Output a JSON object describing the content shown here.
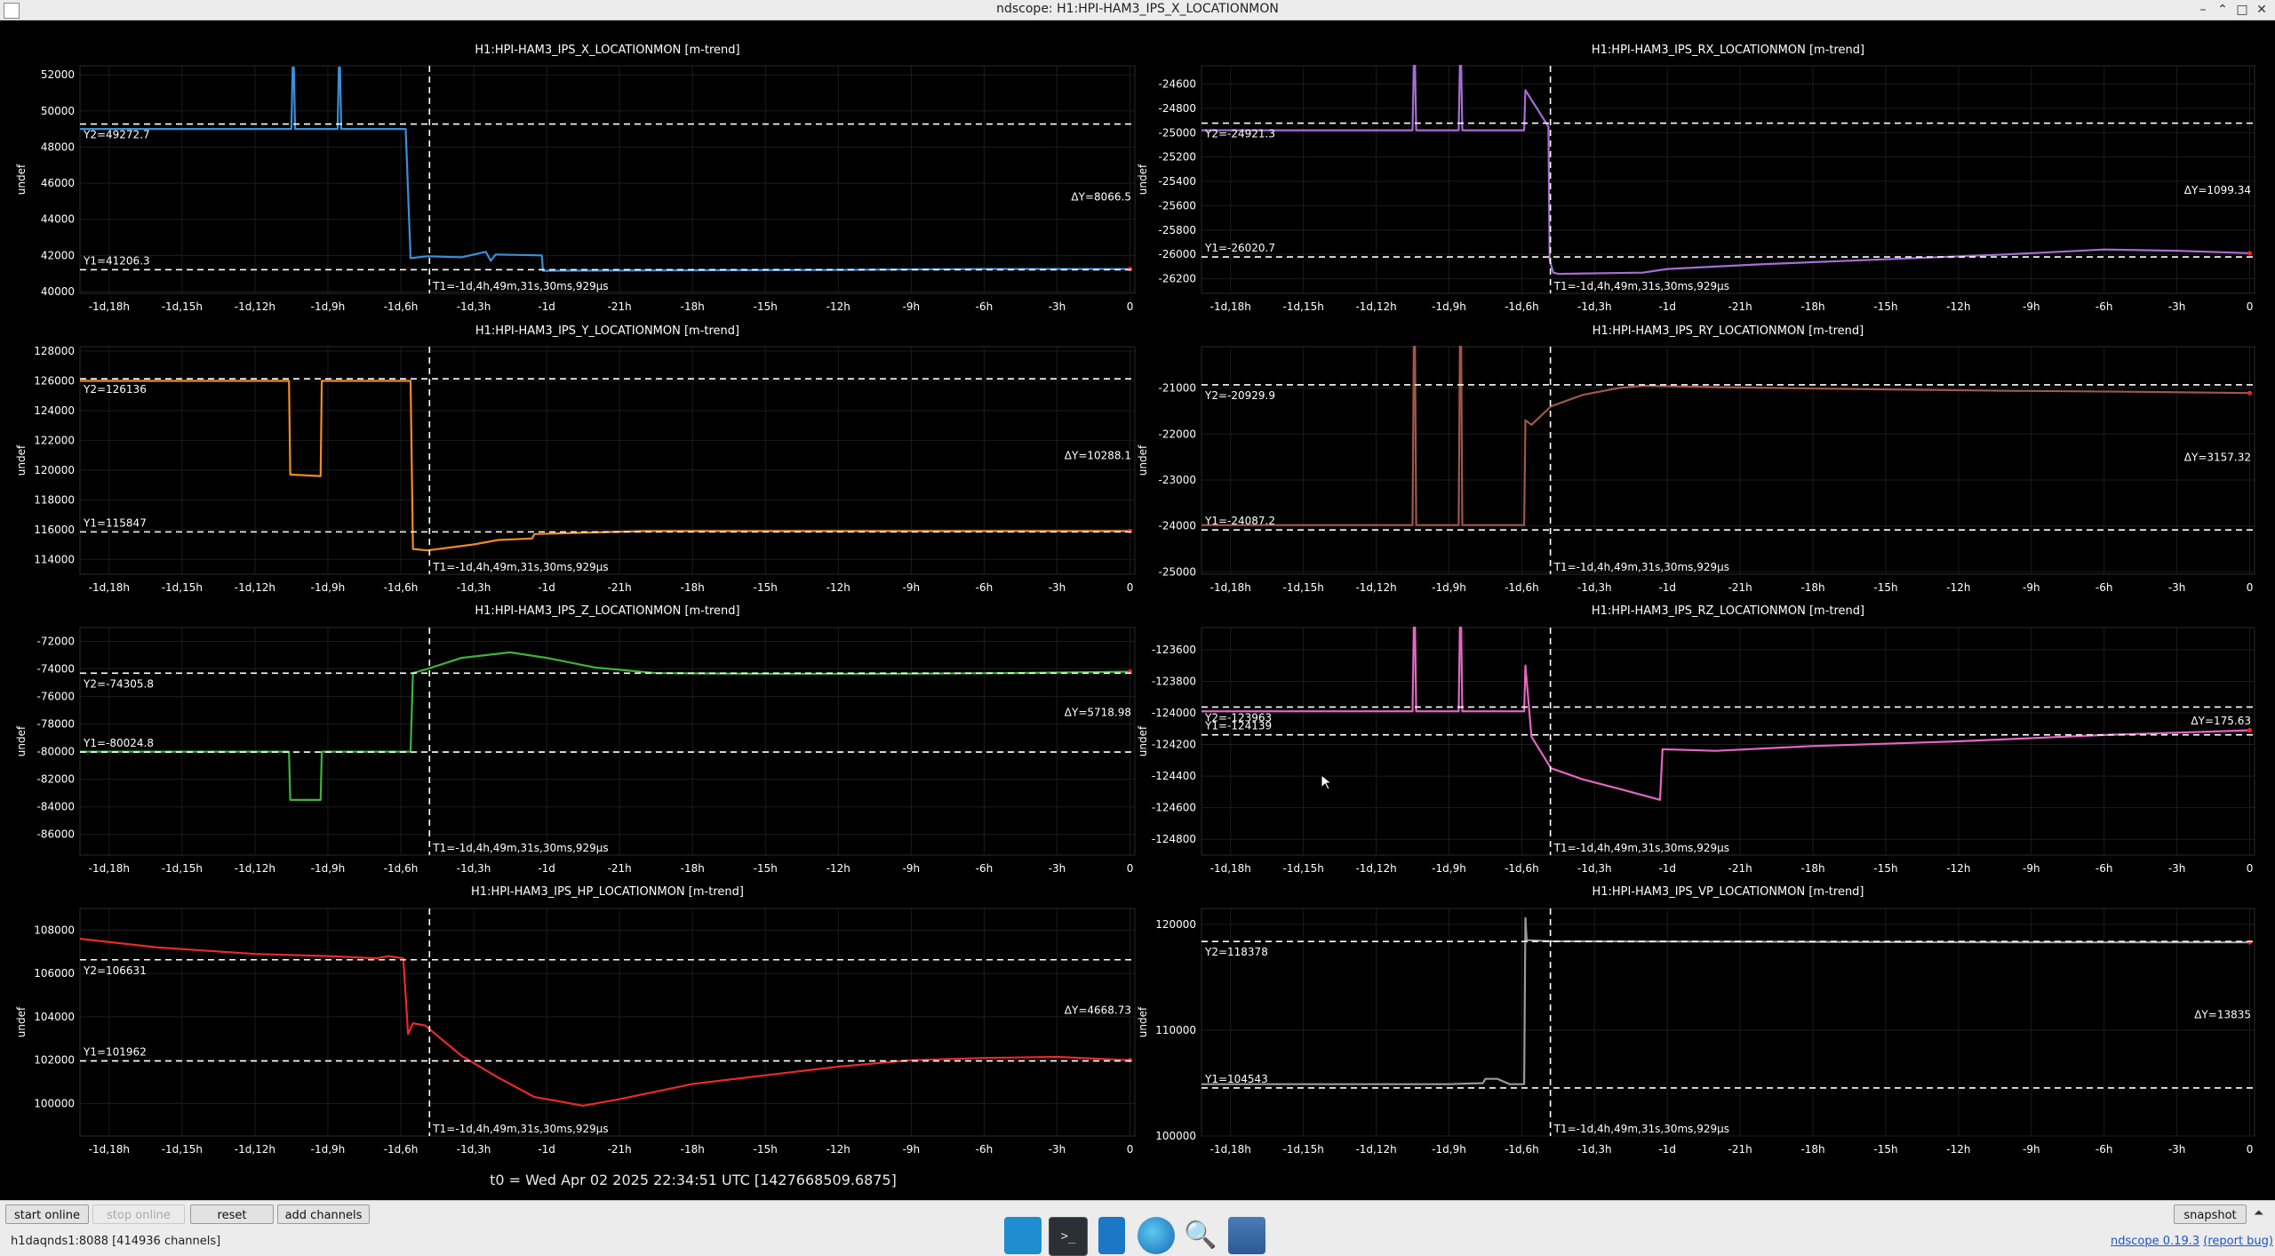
{
  "window": {
    "title": "ndscope: H1:HPI-HAM3_IPS_X_LOCATIONMON",
    "buttons": [
      "–",
      "⌃",
      "□",
      "✕"
    ]
  },
  "axis_common": {
    "ylabel": "undef",
    "x_ticks": [
      "-1d,18h",
      "-1d,15h",
      "-1d,12h",
      "-1d,9h",
      "-1d,6h",
      "-1d,3h",
      "-1d",
      "-21h",
      "-18h",
      "-15h",
      "-12h",
      "-9h",
      "-6h",
      "-3h",
      "0"
    ],
    "x_tick_hours": [
      -42,
      -39,
      -36,
      -33,
      -30,
      -27,
      -24,
      -21,
      -18,
      -15,
      -12,
      -9,
      -6,
      -3,
      0
    ],
    "x_range_hours": [
      -43.2,
      0.2
    ],
    "cursor_x_hours": -28.82,
    "t1_label": "T1=-1d,4h,49m,31s,30ms,929µs"
  },
  "chart_data": [
    {
      "type": "line",
      "title": "H1:HPI-HAM3_IPS_X_LOCATIONMON [m-trend]",
      "color": "#3a8fd8",
      "y_ticks": [
        40000,
        42000,
        44000,
        46000,
        48000,
        50000,
        52000
      ],
      "ylim": [
        39900,
        52500
      ],
      "y1_label": "Y1=41206.3",
      "y1": 41206.3,
      "y2_label": "Y2=49272.7",
      "y2": 49272.7,
      "dy_label": "ΔY=8066.5",
      "x": [
        -43.2,
        -34.5,
        -34.45,
        -34.4,
        -34.35,
        -32.6,
        -32.55,
        -32.5,
        -32.45,
        -29.9,
        -29.8,
        -29.6,
        -28.9,
        -27.5,
        -26.5,
        -26.3,
        -26.1,
        -24.2,
        -24.15,
        -12,
        -6,
        0
      ],
      "y": [
        49000,
        49000,
        52400,
        52400,
        49000,
        49000,
        52400,
        52400,
        49000,
        49000,
        49000,
        41850,
        41950,
        41900,
        42200,
        41700,
        42050,
        42000,
        41150,
        41200,
        41250,
        41250
      ]
    },
    {
      "type": "line",
      "title": "H1:HPI-HAM3_IPS_RX_LOCATIONMON [m-trend]",
      "color": "#a46fd4",
      "y_ticks": [
        -26200,
        -26000,
        -25800,
        -25600,
        -25400,
        -25200,
        -25000,
        -24800,
        -24600
      ],
      "ylim": [
        -26320,
        -24450
      ],
      "y1_label": "Y1=-26020.7",
      "y1": -26020.7,
      "y2_label": "Y2=-24921.3",
      "y2": -24921.3,
      "dy_label": "ΔY=1099.34",
      "x": [
        -43.2,
        -34.5,
        -34.45,
        -34.4,
        -34.35,
        -32.6,
        -32.55,
        -32.5,
        -32.45,
        -29.9,
        -29.85,
        -28.9,
        -28.85,
        -28.7,
        -28.5,
        -25,
        -24,
        -20,
        -15,
        -10,
        -6,
        -3,
        0
      ],
      "y": [
        -24980,
        -24980,
        -24450,
        -24450,
        -24980,
        -24980,
        -24450,
        -24450,
        -24980,
        -24980,
        -24650,
        -24950,
        -26050,
        -26150,
        -26160,
        -26150,
        -26120,
        -26080,
        -26040,
        -26000,
        -25960,
        -25970,
        -25990
      ]
    },
    {
      "type": "line",
      "title": "H1:HPI-HAM3_IPS_Y_LOCATIONMON [m-trend]",
      "color": "#f08a28",
      "y_ticks": [
        114000,
        116000,
        118000,
        120000,
        122000,
        124000,
        126000,
        128000
      ],
      "ylim": [
        113000,
        128300
      ],
      "y1_label": "Y1=115847",
      "y1": 115847,
      "y2_label": "Y2=126136",
      "y2": 126136,
      "dy_label": "ΔY=10288.1",
      "x": [
        -43.2,
        -34.6,
        -34.55,
        -33.3,
        -33.25,
        -32.6,
        -32.55,
        -29.9,
        -29.6,
        -29.5,
        -28.9,
        -27,
        -26,
        -24.6,
        -24.5,
        -20,
        -12,
        -6,
        0
      ],
      "y": [
        126000,
        126000,
        119700,
        119600,
        126000,
        126000,
        126000,
        126000,
        126000,
        114700,
        114600,
        115000,
        115300,
        115400,
        115700,
        115900,
        115900,
        115900,
        115900
      ]
    },
    {
      "type": "line",
      "title": "H1:HPI-HAM3_IPS_RY_LOCATIONMON [m-trend]",
      "color": "#a0564a",
      "y_ticks": [
        -25000,
        -24000,
        -23000,
        -22000,
        -21000
      ],
      "ylim": [
        -25050,
        -20100
      ],
      "y1_label": "Y1=-24087.2",
      "y1": -24087.2,
      "y2_label": "Y2=-20929.9",
      "y2": -20929.9,
      "dy_label": "ΔY=3157.32",
      "x": [
        -43.2,
        -34.5,
        -34.45,
        -34.4,
        -34.35,
        -32.6,
        -32.55,
        -32.5,
        -32.45,
        -29.9,
        -29.85,
        -29.6,
        -28.8,
        -27.5,
        -26,
        -25,
        -22,
        -15,
        -10,
        -5,
        0
      ],
      "y": [
        -23980,
        -23980,
        -20100,
        -20100,
        -23980,
        -23980,
        -20100,
        -20100,
        -23980,
        -23980,
        -21700,
        -21800,
        -21400,
        -21150,
        -21000,
        -20950,
        -20980,
        -21030,
        -21060,
        -21080,
        -21110
      ]
    },
    {
      "type": "line",
      "title": "H1:HPI-HAM3_IPS_Z_LOCATIONMON [m-trend]",
      "color": "#3cb33c",
      "y_ticks": [
        -86000,
        -84000,
        -82000,
        -80000,
        -78000,
        -76000,
        -74000,
        -72000
      ],
      "ylim": [
        -87500,
        -71000
      ],
      "y1_label": "Y1=-80024.8",
      "y1": -80024.8,
      "y2_label": "Y2=-74305.8",
      "y2": -74305.8,
      "dy_label": "ΔY=5718.98",
      "x": [
        -43.2,
        -34.6,
        -34.55,
        -33.3,
        -33.25,
        -32.6,
        -32.55,
        -29.9,
        -29.6,
        -29.5,
        -28.9,
        -27.5,
        -25.5,
        -24,
        -22,
        -19.5,
        -15,
        -10,
        -5,
        0
      ],
      "y": [
        -80000,
        -80000,
        -83500,
        -83500,
        -80000,
        -80000,
        -80000,
        -80000,
        -80000,
        -74300,
        -74000,
        -73200,
        -72800,
        -73200,
        -73900,
        -74300,
        -74350,
        -74350,
        -74300,
        -74200
      ]
    },
    {
      "type": "line",
      "title": "H1:HPI-HAM3_IPS_RZ_LOCATIONMON [m-trend]",
      "color": "#e466c2",
      "y_ticks": [
        -124800,
        -124600,
        -124400,
        -124200,
        -124000,
        -123800,
        -123600
      ],
      "ylim": [
        -124900,
        -123460
      ],
      "y1_label": "Y1=-124139",
      "y1": -124139,
      "y2_label": "Y2=-123963",
      "y2": -123963,
      "dy_label": "ΔY=175.63",
      "x": [
        -43.2,
        -34.5,
        -34.45,
        -34.4,
        -34.35,
        -32.6,
        -32.55,
        -32.5,
        -32.45,
        -29.9,
        -29.85,
        -29.6,
        -28.8,
        -27.5,
        -26,
        -24.3,
        -24.2,
        -22,
        -18,
        -12,
        -6,
        0
      ],
      "y": [
        -123990,
        -123990,
        -123460,
        -123460,
        -123990,
        -123990,
        -123460,
        -123460,
        -123990,
        -123990,
        -123700,
        -124150,
        -124350,
        -124420,
        -124480,
        -124550,
        -124230,
        -124240,
        -124210,
        -124180,
        -124140,
        -124110
      ]
    },
    {
      "type": "line",
      "title": "H1:HPI-HAM3_IPS_HP_LOCATIONMON [m-trend]",
      "color": "#e82a2a",
      "y_ticks": [
        100000,
        102000,
        104000,
        106000,
        108000
      ],
      "ylim": [
        98500,
        109000
      ],
      "y1_label": "Y1=101962",
      "y1": 101962,
      "y2_label": "Y2=106631",
      "y2": 106631,
      "dy_label": "ΔY=4668.73",
      "x": [
        -43.2,
        -40,
        -36,
        -33,
        -31,
        -30.5,
        -29.9,
        -29.7,
        -29.5,
        -29,
        -27.5,
        -26,
        -24.5,
        -22.5,
        -21,
        -18,
        -15,
        -12,
        -9,
        -6,
        -3,
        0
      ],
      "y": [
        107600,
        107200,
        106900,
        106800,
        106700,
        106800,
        106700,
        103200,
        103700,
        103600,
        102200,
        101200,
        100300,
        99900,
        100200,
        100900,
        101300,
        101700,
        102000,
        102100,
        102150,
        102000
      ]
    },
    {
      "type": "line",
      "title": "H1:HPI-HAM3_IPS_VP_LOCATIONMON [m-trend]",
      "color": "#9a9a9a",
      "y_ticks": [
        100000,
        110000,
        120000
      ],
      "ylim": [
        100000,
        121500
      ],
      "y1_label": "Y1=104543",
      "y1": 104543,
      "y2_label": "Y2=118378",
      "y2": 118378,
      "dy_label": "ΔY=13835",
      "x": [
        -43.2,
        -33,
        -31.6,
        -31.5,
        -31,
        -30.5,
        -29.9,
        -29.85,
        -29.8,
        -28.8,
        -20,
        -10,
        0
      ],
      "y": [
        104900,
        104900,
        105000,
        105400,
        105400,
        104900,
        104900,
        120600,
        118500,
        118400,
        118350,
        118300,
        118300
      ]
    }
  ],
  "t0_label": "t0 = Wed Apr 02 2025 22:34:51 UTC [1427668509.6875]",
  "toolbar": {
    "start_online": "start online",
    "stop_online": "stop online",
    "reset": "reset",
    "add_channels": "add channels",
    "snapshot": "snapshot"
  },
  "status": {
    "server": "h1daqnds1:8088 [414936 channels]",
    "version": "ndscope 0.19.3",
    "report_bug": "(report bug)"
  },
  "taskbar": {
    "icons": [
      "desktop-icon",
      "terminal-icon",
      "text-editor-icon",
      "browser-icon",
      "search-icon",
      "file-manager-icon"
    ]
  }
}
